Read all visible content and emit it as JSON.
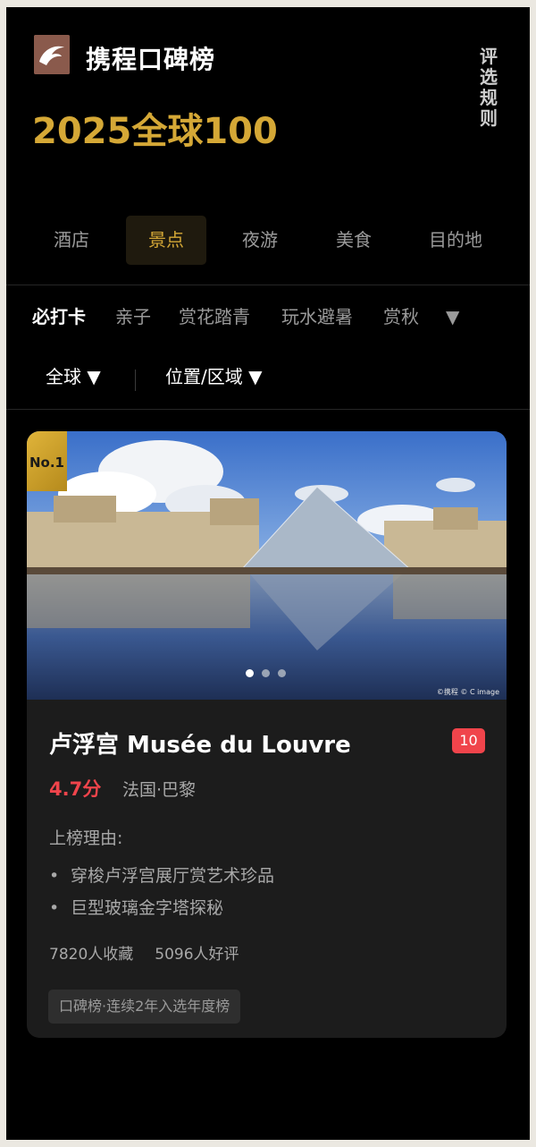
{
  "header": {
    "brand_title": "携程口碑榜",
    "rules_link": "评选规则",
    "year_title": "2025全球100"
  },
  "tabs": [
    {
      "label": "酒店",
      "active": false
    },
    {
      "label": "景点",
      "active": true
    },
    {
      "label": "夜游",
      "active": false
    },
    {
      "label": "美食",
      "active": false
    },
    {
      "label": "目的地",
      "active": false
    }
  ],
  "filters": {
    "items": [
      {
        "label": "必打卡",
        "active": true
      },
      {
        "label": "亲子",
        "active": false
      },
      {
        "label": "赏花踏青",
        "active": false
      },
      {
        "label": "玩水避暑",
        "active": false
      },
      {
        "label": "赏秋",
        "active": false
      }
    ],
    "more": "▼",
    "region": "全球 ▼",
    "location": "位置/区域 ▼"
  },
  "card": {
    "rank": "No.1",
    "name": "卢浮宫 Musée du Louvre",
    "count_badge": "10",
    "score": "4.7分",
    "location": "法国·巴黎",
    "reason_title": "上榜理由:",
    "reasons": [
      "穿梭卢浮宫展厅赏艺术珍品",
      "巨型玻璃金字塔探秘"
    ],
    "favorites": "7820人收藏",
    "good_reviews": "5096人好评",
    "tag": "口碑榜·连续2年入选年度榜",
    "photo_credit": "©携程 © C image",
    "carousel": {
      "total": 3,
      "active_index": 0
    }
  },
  "colors": {
    "gold": "#d5a836",
    "red": "#f0444b",
    "background": "#000000",
    "card": "#1c1c1c"
  }
}
